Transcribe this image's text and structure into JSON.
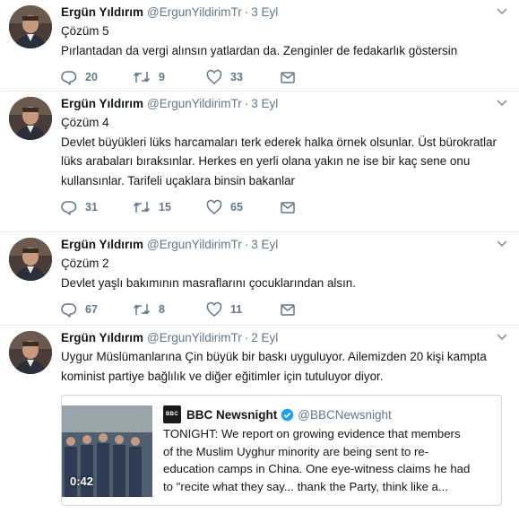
{
  "tweets": [
    {
      "author": "Ergün Yıldırım",
      "handle": "@ErgunYildirimTr",
      "separator": "·",
      "time": "3 Eyl",
      "lines": [
        "Çözüm 5",
        "Pırlantadan da vergi alınsın yatlardan da. Zenginler de fedakarlık göstersin"
      ],
      "replies": "20",
      "retweets": "9",
      "likes": "33"
    },
    {
      "author": "Ergün Yıldırım",
      "handle": "@ErgunYildirimTr",
      "separator": "·",
      "time": "3 Eyl",
      "lines": [
        "Çözüm 4",
        "Devlet büyükleri lüks harcamaları terk ederek halka örnek olsunlar. Üst bürokratlar",
        "lüks arabaları bıraksınlar. Herkes en yerli olana yakın ne ise bir kaç sene onu",
        "kullansınlar. Tarifeli uçaklara binsin bakanlar"
      ],
      "replies": "31",
      "retweets": "15",
      "likes": "65"
    },
    {
      "author": "Ergün Yıldırım",
      "handle": "@ErgunYildirimTr",
      "separator": "·",
      "time": "3 Eyl",
      "lines": [
        "Çözüm 2",
        "Devlet yaşlı bakımının masraflarını çocuklarından alsın."
      ],
      "replies": "67",
      "retweets": "8",
      "likes": "11"
    },
    {
      "author": "Ergün Yıldırım",
      "handle": "@ErgunYildirimTr",
      "separator": "·",
      "time": "2 Eyl",
      "lines": [
        "Uygur Müslümanlarına Çin büyük bir baskı uyguluyor. Ailemizden 20 kişi kampta",
        "kominist partiye bağlılık ve diğer eğitimler için tutuluyor diyor."
      ],
      "card": {
        "logo_text": "BBC",
        "logo_subtext": "newsnight",
        "name": "BBC Newsnight",
        "handle": "@BBCNewsnight",
        "duration": "0:42",
        "lines": [
          "TONIGHT: We report on growing evidence that members",
          "of the Muslim Uyghur minority are being sent to re-",
          "education camps in China. One eye-witness claims he had",
          "to \"recite what they say... thank the Party, think like a..."
        ]
      }
    }
  ],
  "colors": {
    "text": "#14171a",
    "secondary": "#657786",
    "border": "#e6ecf0",
    "verified": "#1da1f2"
  },
  "icons": [
    "avatar",
    "chevron-down-icon",
    "reply-icon",
    "retweet-icon",
    "like-icon",
    "direct-message-icon",
    "verified-icon",
    "video-thumbnail"
  ]
}
